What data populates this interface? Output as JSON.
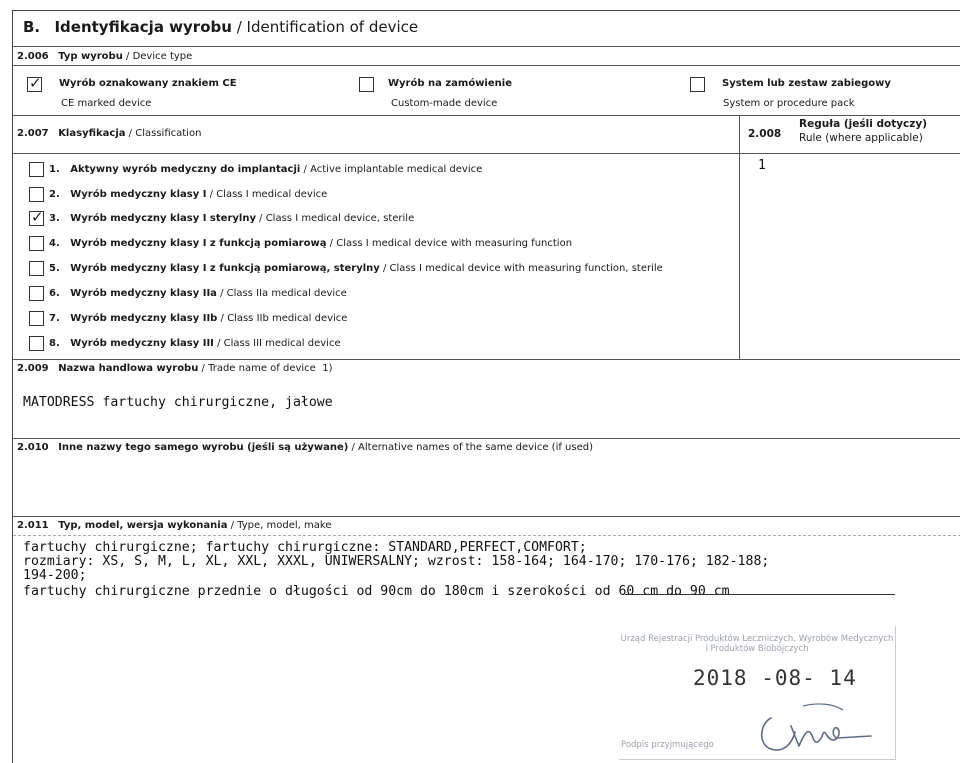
{
  "section": {
    "letter": "B.",
    "title_pl": "Identyfikacja wyrobu",
    "sep": " / ",
    "title_en": "Identification of device"
  },
  "device_type": {
    "code": "2.006",
    "label_pl": "Typ wyrobu",
    "label_en": "Device type",
    "options": [
      {
        "checked": true,
        "pl": "Wyrób oznakowany znakiem CE",
        "en": "CE marked device"
      },
      {
        "checked": false,
        "pl": "Wyrób na zamówienie",
        "en": "Custom-made device"
      },
      {
        "checked": false,
        "pl": "System lub zestaw zabiegowy",
        "en": "System or procedure pack"
      }
    ]
  },
  "classification": {
    "code": "2.007",
    "label_pl": "Klasyfikacja",
    "label_en": "Classification",
    "items": [
      {
        "checked": false,
        "num": "1.",
        "pl": "Aktywny wyrób medyczny do implantacji",
        "en": "Active implantable medical device"
      },
      {
        "checked": false,
        "num": "2.",
        "pl": "Wyrób medyczny klasy I",
        "en": "Class I medical device"
      },
      {
        "checked": true,
        "num": "3.",
        "pl": "Wyrób medyczny klasy I sterylny",
        "en": "Class I medical device, sterile"
      },
      {
        "checked": false,
        "num": "4.",
        "pl": "Wyrób medyczny klasy I z funkcją pomiarową",
        "en": "Class I medical device with measuring function"
      },
      {
        "checked": false,
        "num": "5.",
        "pl": "Wyrób medyczny klasy I z funkcją pomiarową, sterylny",
        "en": "Class I medical device with measuring function, sterile"
      },
      {
        "checked": false,
        "num": "6.",
        "pl": "Wyrób medyczny klasy IIa",
        "en": "Class IIa medical device"
      },
      {
        "checked": false,
        "num": "7.",
        "pl": "Wyrób medyczny klasy IIb",
        "en": "Class IIb medical device"
      },
      {
        "checked": false,
        "num": "8.",
        "pl": "Wyrób medyczny klasy III",
        "en": "Class III medical device"
      }
    ]
  },
  "rule": {
    "code": "2.008",
    "label_pl": "Reguła (jeśli dotyczy)",
    "label_en": "Rule (where applicable)",
    "value": "1"
  },
  "trade_name": {
    "code": "2.009",
    "label_pl": "Nazwa handlowa wyrobu",
    "label_en": "Trade name of device",
    "footnote": "1)",
    "value": "MATODRESS fartuchy chirurgiczne, jałowe"
  },
  "alt_names": {
    "code": "2.010",
    "label_pl": "Inne nazwy tego samego wyrobu (jeśli są używane)",
    "label_en": "Alternative names of the same device (if used)"
  },
  "make": {
    "code": "2.011",
    "label_pl": "Typ, model, wersja wykonania",
    "label_en": "Type, model, make",
    "lines": [
      "fartuchy chirurgiczne; fartuchy chirurgiczne: STANDARD,PERFECT,COMFORT;",
      "rozmiary: XS, S, M, L, XL, XXL, XXXL, UNIWERSALNY; wzrost: 158-164; 164-170; 170-176; 182-188;",
      "194-200;",
      "fartuchy chirurgiczne przednie o długości od 90cm do 180cm i szerokości od 60 cm do 90 cm"
    ]
  },
  "stamp": {
    "header": "Urząd Rejestracji Produktów Leczniczych, Wyrobów Medycznych i Produktów Biobójczych",
    "date": "2018 -08- 14",
    "footer": "Podpis przyjmującego"
  },
  "check_glyph": "✓"
}
